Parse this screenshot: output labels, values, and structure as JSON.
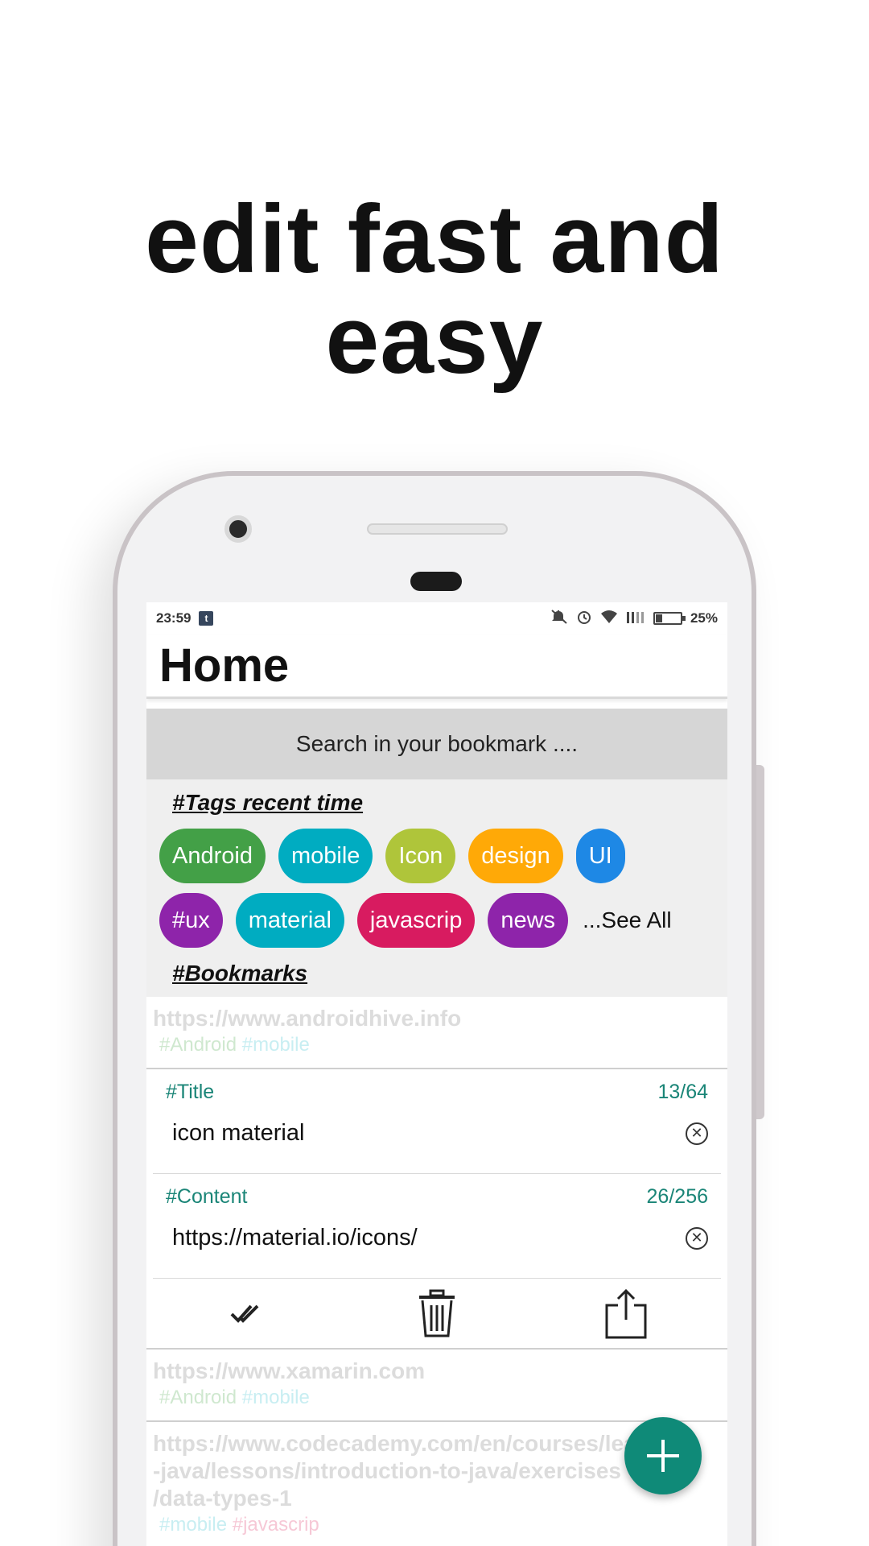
{
  "headline": {
    "line1": "edit fast and",
    "line2": "easy"
  },
  "status_bar": {
    "time": "23:59",
    "app_icon": "tumblr-icon",
    "icons": [
      "mute-icon",
      "alarm-icon",
      "wifi-icon",
      "signal-icon",
      "battery-icon"
    ],
    "battery": "25%",
    "battery_level": 0.25
  },
  "app_bar": {
    "title": "Home"
  },
  "search": {
    "placeholder": "Search in your bookmark ...."
  },
  "tags_section": {
    "title": "#Tags recent time",
    "row1": [
      {
        "label": "Android",
        "color": "#43a047"
      },
      {
        "label": "mobile",
        "color": "#00acc1"
      },
      {
        "label": "Icon",
        "color": "#afc53a"
      },
      {
        "label": "design",
        "color": "#ffa907"
      },
      {
        "label": "UI",
        "color": "#1e88e5"
      }
    ],
    "row2": [
      {
        "label": "#ux",
        "color": "#8e24aa"
      },
      {
        "label": "material",
        "color": "#00acc1"
      },
      {
        "label": "javascrip",
        "color": "#d81b60"
      },
      {
        "label": "news",
        "color": "#8e24aa"
      }
    ],
    "see_all": "...See All"
  },
  "bookmarks_section": {
    "title": "#Bookmarks"
  },
  "bookmarks": [
    {
      "url": "https://www.androidhive.info",
      "tags": [
        "#Android",
        "#mobile"
      ]
    },
    {
      "url": "https://www.xamarin.com",
      "tags": [
        "#Android",
        "#mobile"
      ]
    },
    {
      "url_lines": [
        "https://www.codecademy.com/en/courses/learn",
        "-java/lessons/introduction-to-java/exercises",
        "/data-types-1"
      ],
      "tags": [
        "#mobile",
        "#javascrip"
      ]
    }
  ],
  "edit_card": {
    "title_field": {
      "label": "#Title",
      "counter": "13/64",
      "value": "icon material"
    },
    "content_field": {
      "label": "#Content",
      "counter": "26/256",
      "value": "https://material.io/icons/"
    },
    "actions": [
      "done-all-icon",
      "delete-icon",
      "share-icon"
    ]
  },
  "fab": {
    "icon": "plus-icon",
    "color": "#0f8a78"
  }
}
